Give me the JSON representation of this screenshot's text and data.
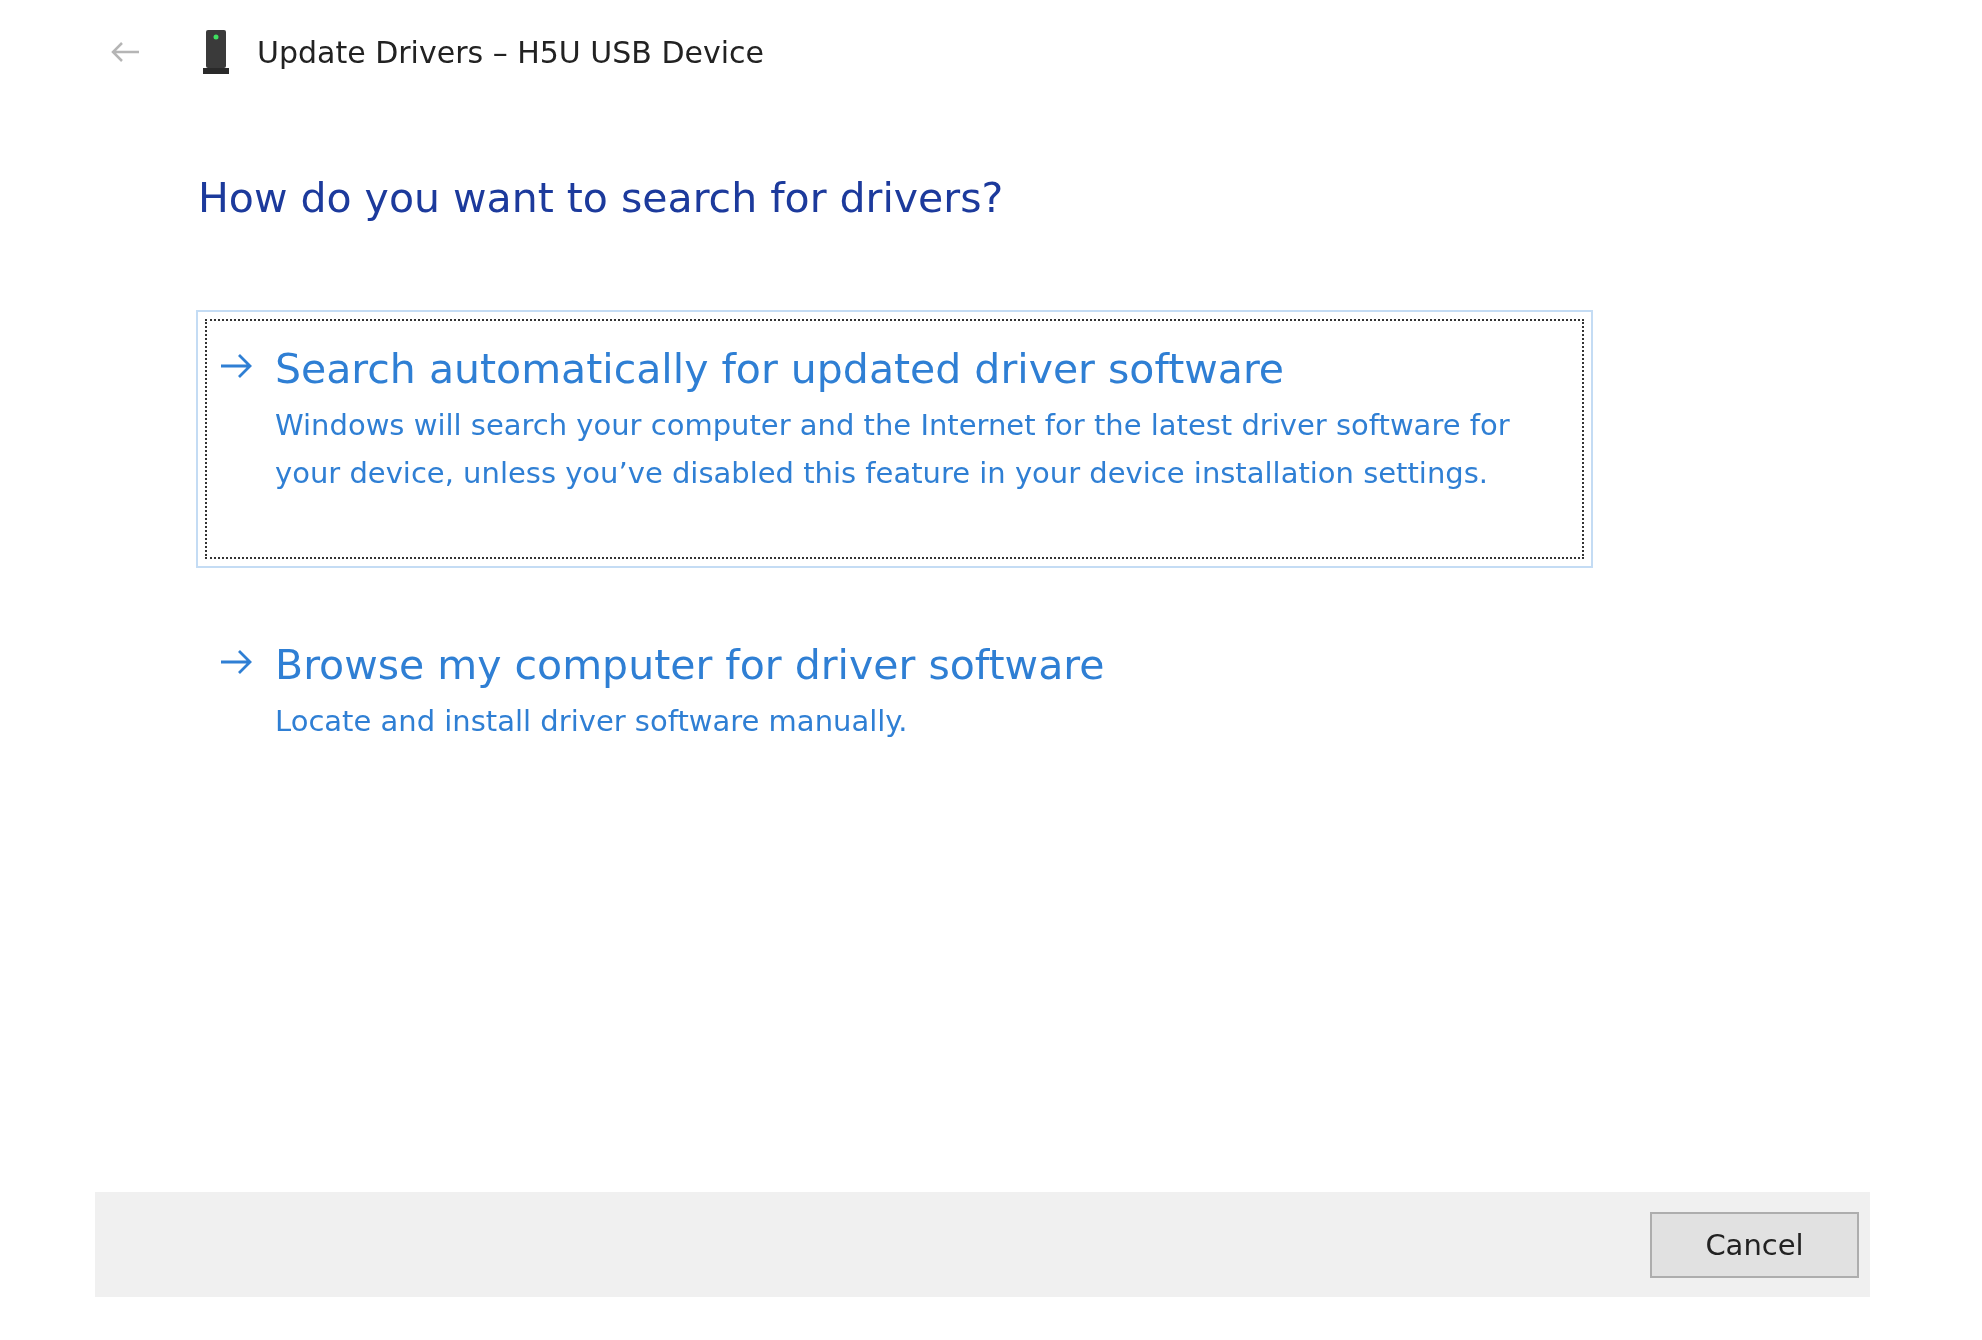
{
  "window": {
    "title": "Update Drivers – H5U USB Device"
  },
  "heading": "How do you want to search for drivers?",
  "options": [
    {
      "title": "Search automatically for updated driver software",
      "description": "Windows will search your computer and the Internet for the latest driver software for your device, unless you’ve disabled this feature in your device installation settings.",
      "selected": true
    },
    {
      "title": "Browse my computer for driver software",
      "description": "Locate and install driver software manually.",
      "selected": false
    }
  ],
  "buttons": [
    "Cancel"
  ]
}
